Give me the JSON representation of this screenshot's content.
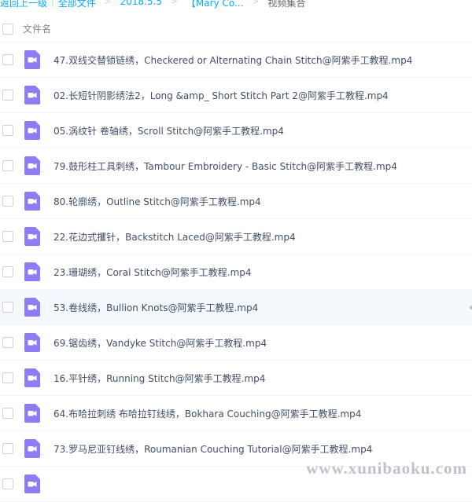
{
  "breadcrumb": {
    "back": "返回上一级",
    "all_files": "全部文件",
    "level1": "2018.5.5",
    "level2": "【Mary Co...",
    "current": "视频集合"
  },
  "header": {
    "column_name": "文件名"
  },
  "files": [
    "47.双线交替锁链绣，Checkered or Alternating Chain Stitch@阿紫手工教程.mp4",
    "02.长短针阴影绣法2，Long &amp_ Short Stitch Part 2@阿紫手工教程.mp4",
    "05.涡纹针 卷轴绣，Scroll Stitch@阿紫手工教程.mp4",
    "79.鼓形柱工具刺绣，Tambour Embroidery - Basic Stitch@阿紫手工教程.mp4",
    "80.轮廓绣，Outline Stitch@阿紫手工教程.mp4",
    "22.花边式攫针，Backstitch Laced@阿紫手工教程.mp4",
    "23.珊瑚绣，Coral Stitch@阿紫手工教程.mp4",
    "53.卷线绣，Bullion Knots@阿紫手工教程.mp4",
    "69.锯齿绣，Vandyke Stitch@阿紫手工教程.mp4",
    "16.平针绣，Running Stitch@阿紫手工教程.mp4",
    "64.布哈拉刺绣 布哈拉钉线绣，Bokhara Couching@阿紫手工教程.mp4",
    "73.罗马尼亚钉线绣，Roumanian Couching Tutorial@阿紫手工教程.mp4"
  ],
  "watermark": "www.xunibaoku.com",
  "colors": {
    "link": "#09aaff",
    "video_icon": "#8e7cf5",
    "text": "#424e67"
  }
}
